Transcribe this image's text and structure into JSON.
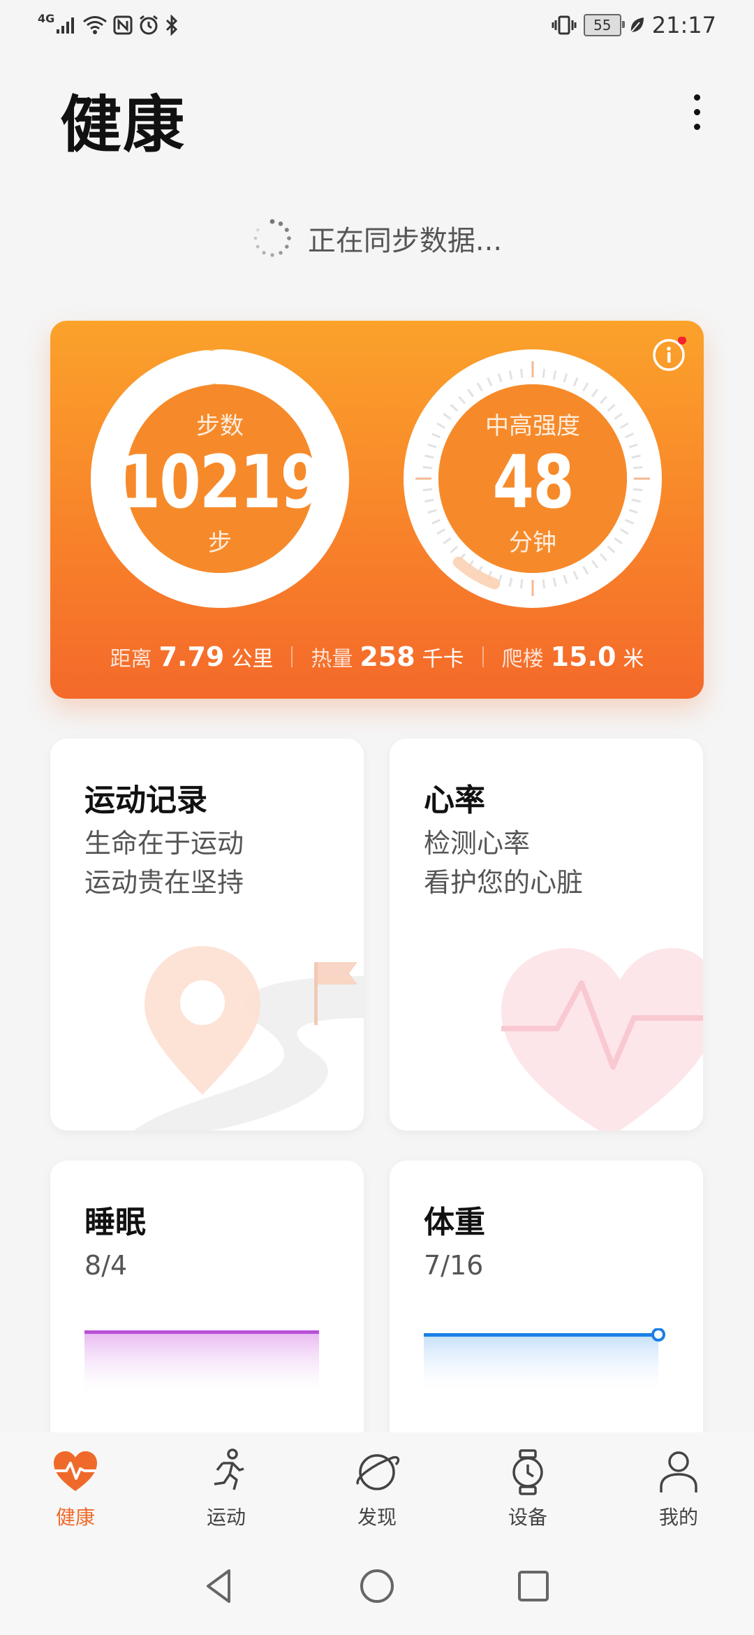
{
  "status_bar": {
    "network_type": "4G",
    "battery_level": "55",
    "time": "21:17",
    "icons": [
      "signal-icon",
      "wifi-icon",
      "nfc-icon",
      "alarm-icon",
      "bluetooth-icon",
      "vibrate-icon",
      "battery-icon",
      "leaf-icon"
    ]
  },
  "header": {
    "title": "健康"
  },
  "sync": {
    "text": "正在同步数据..."
  },
  "activity": {
    "steps": {
      "label": "步数",
      "value": "10219",
      "unit": "步",
      "progress": 0.98
    },
    "intensity": {
      "label": "中高强度",
      "value": "48",
      "unit": "分钟",
      "progress": 0.06
    },
    "stats": [
      {
        "label": "距离",
        "value": "7.79",
        "unit": "公里"
      },
      {
        "label": "热量",
        "value": "258",
        "unit": "千卡"
      },
      {
        "label": "爬楼",
        "value": "15.0",
        "unit": "米"
      }
    ],
    "colors": {
      "gradient_top": "#fba22b",
      "gradient_bottom": "#f4692a"
    }
  },
  "cards": {
    "exercise": {
      "title": "运动记录",
      "line1": "生命在于运动",
      "line2": "运动贵在坚持"
    },
    "heart": {
      "title": "心率",
      "line1": "检测心率",
      "line2": "看护您的心脏"
    },
    "sleep": {
      "title": "睡眠",
      "date": "8/4",
      "color": "#b94fd6"
    },
    "weight": {
      "title": "体重",
      "date": "7/16",
      "color": "#1a7fe6"
    }
  },
  "bottom_nav": [
    {
      "label": "健康",
      "icon": "heart-pulse-icon",
      "active": true
    },
    {
      "label": "运动",
      "icon": "runner-icon",
      "active": false
    },
    {
      "label": "发现",
      "icon": "planet-icon",
      "active": false
    },
    {
      "label": "设备",
      "icon": "watch-icon",
      "active": false
    },
    {
      "label": "我的",
      "icon": "person-icon",
      "active": false
    }
  ],
  "accent_color": "#ef6a2a"
}
